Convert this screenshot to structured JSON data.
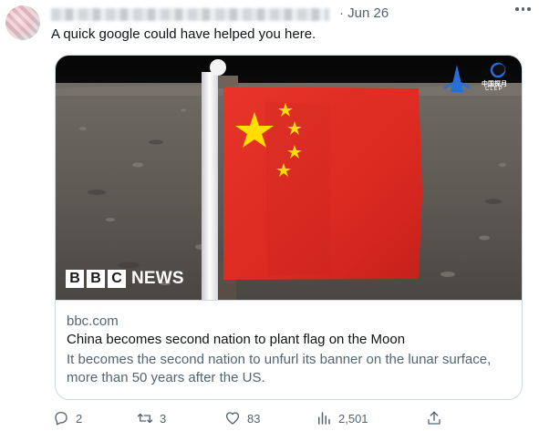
{
  "tweet": {
    "timestamp": "Jun 26",
    "separator": "·",
    "text": "A quick google could have helped you here."
  },
  "card": {
    "image_overlay": {
      "bbc_letters": [
        "B",
        "B",
        "C"
      ],
      "bbc_word": "NEWS",
      "clep_label": "中国探月",
      "clep_sub": "CLEP"
    },
    "domain": "bbc.com",
    "headline": "China becomes second nation to plant flag on the Moon",
    "description": "It becomes the second nation to unfurl its banner on the lunar surface, more than 50 years after the US."
  },
  "actions": {
    "replies": "2",
    "reposts": "3",
    "likes": "83",
    "views": "2,501"
  },
  "colors": {
    "secondary_text": "#536471",
    "primary_text": "#0f1419",
    "border": "#cfd9de",
    "flag_red": "#e02a22",
    "flag_star": "#ffde00"
  },
  "icons": [
    "more-icon",
    "reply-icon",
    "repost-icon",
    "like-icon",
    "views-icon",
    "share-icon"
  ]
}
